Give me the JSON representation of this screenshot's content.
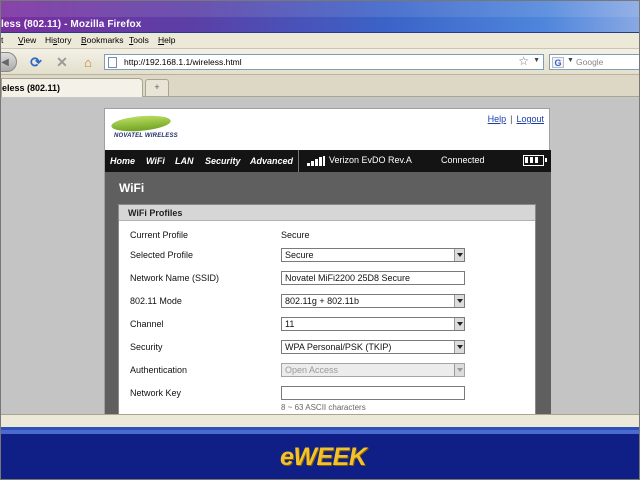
{
  "window": {
    "title": "less (802.11) - Mozilla Firefox"
  },
  "menubar": {
    "items": [
      {
        "pre": "",
        "accel": "",
        "rest": "t"
      },
      {
        "pre": "",
        "accel": "V",
        "rest": "iew"
      },
      {
        "pre": "Hi",
        "accel": "s",
        "rest": "tory"
      },
      {
        "pre": "",
        "accel": "B",
        "rest": "ookmarks"
      },
      {
        "pre": "",
        "accel": "T",
        "rest": "ools"
      },
      {
        "pre": "",
        "accel": "H",
        "rest": "elp"
      }
    ]
  },
  "navbar": {
    "url": "http://192.168.1.1/wireless.html",
    "search_placeholder": "Google",
    "search_engine_glyph": "G"
  },
  "tabs": [
    {
      "label": "eless (802.11)"
    }
  ],
  "newtab_glyph": "+",
  "router": {
    "brand": "NOVATEL WIRELESS",
    "links": {
      "help": "Help",
      "separator": "|",
      "logout": "Logout"
    },
    "nav": [
      "Home",
      "WiFi",
      "LAN",
      "Security",
      "Advanced"
    ],
    "carrier": "Verizon  EvDO Rev.A",
    "connection_status": "Connected",
    "page_title": "WiFi",
    "panel_title": "WiFi Profiles",
    "rows": [
      {
        "label": "Current Profile",
        "kind": "text",
        "value": "Secure"
      },
      {
        "label": "Selected Profile",
        "kind": "select",
        "value": "Secure"
      },
      {
        "label": "Network Name (SSID)",
        "kind": "input",
        "value": "Novatel MiFi2200 25D8 Secure"
      },
      {
        "label": "802.11 Mode",
        "kind": "select",
        "value": "802.11g + 802.11b"
      },
      {
        "label": "Channel",
        "kind": "select",
        "value": "11"
      },
      {
        "label": "Security",
        "kind": "select",
        "value": "WPA Personal/PSK (TKIP)"
      },
      {
        "label": "Authentication",
        "kind": "select-disabled",
        "value": "Open Access"
      },
      {
        "label": "Network Key",
        "kind": "input",
        "value": ""
      }
    ],
    "key_hint": "8 ~ 63 ASCII characters"
  },
  "footer": {
    "brand_e": "e",
    "brand_rest": "WEEK"
  },
  "colors": {
    "nav_band": "#141414",
    "gray_zone": "#5f5f5f",
    "footer_blue": "#0f1f86",
    "brand_yellow": "#f2c12e",
    "link_blue": "#1c3fa8"
  }
}
